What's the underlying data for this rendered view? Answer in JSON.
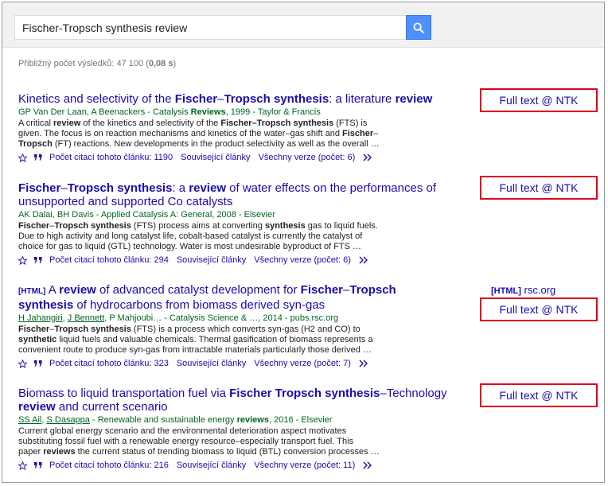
{
  "search": {
    "query": "Fischer-Tropsch synthesis review"
  },
  "stats": {
    "prefix": "Přibližný počet výsledků: 47 100 (",
    "time": "0,08 s",
    "suffix": ")"
  },
  "labels": {
    "cited_prefix": "Počet citací tohoto článku: ",
    "related": "Související články",
    "versions_prefix": "Všechny verze (počet: ",
    "versions_suffix": ")",
    "full_text": "Full text @ NTK",
    "html_tag": "[HTML]"
  },
  "results": [
    {
      "title_parts": [
        "Kinetics and selectivity of the ",
        "Fischer",
        "–",
        "Tropsch synthesis",
        ": a literature ",
        "review"
      ],
      "authors": "GP Van Der Laan, A Beenackers - Catalysis ",
      "authors_bold": "Reviews",
      "authors_tail": ", 1999 - Taylor & Francis",
      "snippet_1a": "A critical ",
      "snippet_1b": "review",
      "snippet_1c": " of the kinetics and selectivity of the ",
      "snippet_1d": "Fischer–Tropsch synthesis",
      "snippet_1e": " (FTS) is",
      "snippet_2": "given. The focus is on reaction mechanisms and kinetics of the water–gas shift and ",
      "snippet_2b": "Fischer",
      "snippet_2c": "–",
      "snippet_3a": "Tropsch",
      "snippet_3b": " (FT) reactions. New developments in the product selectivity as well as the overall …",
      "cited": "1190",
      "versions": "6"
    },
    {
      "title_a": "Fischer",
      "title_b": "–",
      "title_c": "Tropsch synthesis",
      "title_d": ": a ",
      "title_e": "review",
      "title_f": " of water effects on the performances of",
      "title_g": "unsupported and supported Co catalysts",
      "authors": "AK Dalai, BH Davis - Applied Catalysis A: General, 2008 - Elsevier",
      "snippet_1a": "Fischer",
      "snippet_1b": "–",
      "snippet_1c": "Tropsch synthesis",
      "snippet_1d": " (FTS) process aims at converting ",
      "snippet_1e": "synthesis",
      "snippet_1f": " gas to liquid fuels.",
      "snippet_2": "Due to high activity and long catalyst life, cobalt-based catalyst is currently the catalyst of",
      "snippet_3": "choice for gas to liquid (GTL) technology. Water is most undesirable byproduct of FTS …",
      "cited": "294",
      "versions": "6"
    },
    {
      "title_a": " A ",
      "title_b": "review",
      "title_c": " of advanced catalyst development for ",
      "title_d": "Fischer",
      "title_e": "–",
      "title_f": "Tropsch",
      "title_g": "synthesis",
      "title_h": " of hydrocarbons from biomass derived syn-gas",
      "author_1": "H Jahangiri",
      "author_sep1": ", ",
      "author_2": "J Bennett",
      "authors_tail": ", P Mahjoubi… - Catalysis Science & …, 2014 - pubs.rsc.org",
      "snippet_1a": "Fischer",
      "snippet_1b": "–",
      "snippet_1c": "Tropsch synthesis",
      "snippet_1d": " (FTS) is a process which converts syn-gas (H2 and CO) to",
      "snippet_2a": "synthetic",
      "snippet_2b": " liquid fuels and valuable chemicals. Thermal gasification of biomass represents a",
      "snippet_3": "convenient route to produce syn-gas from intractable materials particularly those derived …",
      "cited": "323",
      "versions": "7",
      "html_source": "rsc.org"
    },
    {
      "title_a": "Biomass to liquid transportation fuel via ",
      "title_b": "Fischer Tropsch synthesis",
      "title_c": "–Technology",
      "title_d": "review",
      "title_e": " and current scenario",
      "author_1": "SS Ail",
      "author_sep1": ", ",
      "author_2": "S Dasappa",
      "authors_tail_a": " - Renewable and sustainable energy ",
      "authors_tail_b": "reviews",
      "authors_tail_c": ", 2016 - Elsevier",
      "snippet_1": "Current global energy scenario and the environmental deterioration aspect motivates",
      "snippet_2": "substituting fossil fuel with a renewable energy resource–especially transport fuel. This",
      "snippet_3a": "paper ",
      "snippet_3b": "reviews",
      "snippet_3c": " the current status of trending biomass to liquid (BTL) conversion processes …",
      "cited": "216",
      "versions": "11"
    }
  ],
  "icons": {
    "search": "search-icon",
    "star": "star-icon",
    "cite": "cite-icon",
    "more": "more-icon"
  },
  "colors": {
    "link": "#1a0dab",
    "green": "#006621",
    "red_box": "#e0001b",
    "search_btn": "#4d90fe"
  }
}
